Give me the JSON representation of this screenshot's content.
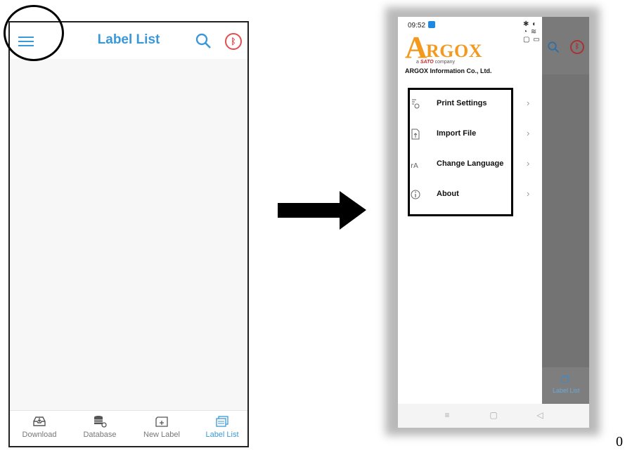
{
  "left_screen": {
    "title": "Label List",
    "bottom_nav": [
      {
        "label": "Download",
        "icon": "download-tray-icon",
        "active": false
      },
      {
        "label": "Database",
        "icon": "database-icon",
        "active": false
      },
      {
        "label": "New Label",
        "icon": "new-label-icon",
        "active": false
      },
      {
        "label": "Label List",
        "icon": "label-list-icon",
        "active": true
      }
    ]
  },
  "right_screen": {
    "status_time": "09:52",
    "logo_text": "ARGOX",
    "tagline_prefix": "a",
    "tagline_brand": "SATO",
    "tagline_suffix": "company",
    "company_name": "ARGOX Information Co., Ltd.",
    "menu": [
      {
        "label": "Print Settings",
        "icon": "print-settings-icon"
      },
      {
        "label": "Import File",
        "icon": "import-file-icon"
      },
      {
        "label": "Change Language",
        "icon": "language-icon"
      },
      {
        "label": "About",
        "icon": "info-icon"
      }
    ],
    "background_nav_label": "Label List"
  },
  "page_number": "0",
  "colors": {
    "accent": "#3a98d8",
    "bluetooth_off": "#e34d4d",
    "logo": "#f39a1e"
  }
}
